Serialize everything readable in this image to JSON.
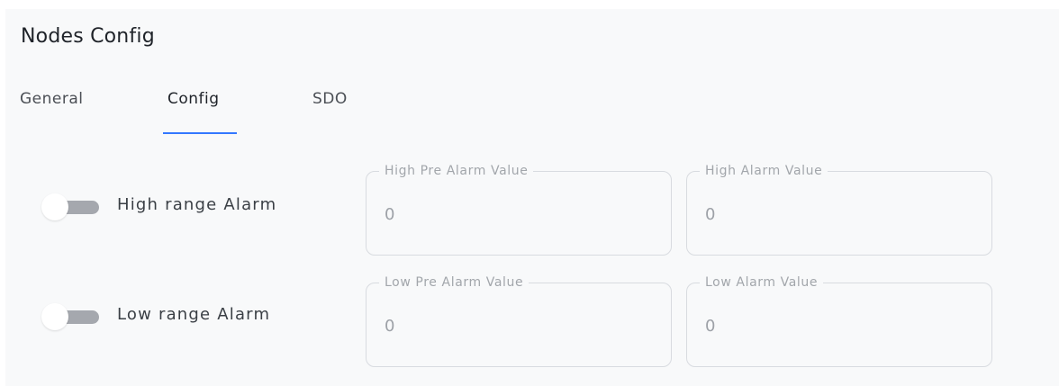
{
  "page": {
    "title": "Nodes Config"
  },
  "tabs": [
    {
      "label": "General",
      "active": false
    },
    {
      "label": "Config",
      "active": true
    },
    {
      "label": "SDO",
      "active": false
    }
  ],
  "colors": {
    "accent": "#3377ff",
    "toggle_track": "#a5a8ae",
    "panel_background": "#f8f9fa"
  },
  "alarms": {
    "high": {
      "toggle_label": "High range Alarm",
      "toggle_on": false,
      "fields": [
        {
          "label": "High Pre Alarm Value",
          "value": "0"
        },
        {
          "label": "High Alarm Value",
          "value": "0"
        }
      ]
    },
    "low": {
      "toggle_label": "Low range Alarm",
      "toggle_on": false,
      "fields": [
        {
          "label": "Low Pre Alarm Value",
          "value": "0"
        },
        {
          "label": "Low Alarm Value",
          "value": "0"
        }
      ]
    }
  }
}
